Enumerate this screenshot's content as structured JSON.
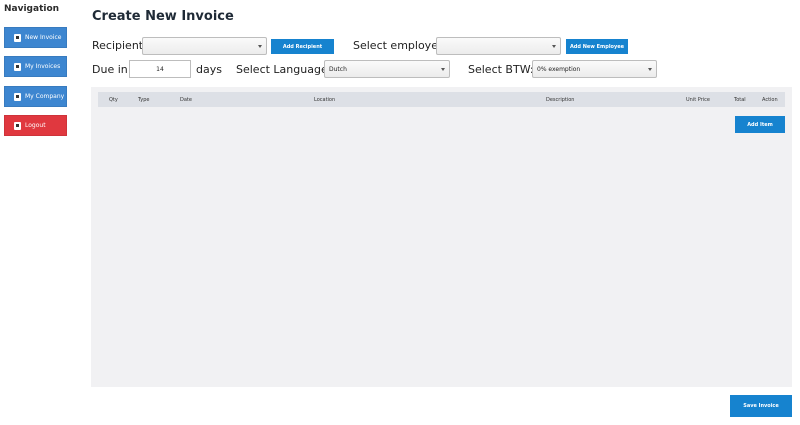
{
  "nav": {
    "title": "Navigation",
    "items": [
      {
        "label": "New Invoice",
        "icon": "user-icon"
      },
      {
        "label": "My Invoices",
        "icon": "invoice-icon"
      },
      {
        "label": "My Company",
        "icon": "company-icon"
      },
      {
        "label": "Logout",
        "icon": "logout-icon"
      }
    ]
  },
  "page": {
    "title": "Create New Invoice"
  },
  "form": {
    "recipient_label": "Recipient:",
    "recipient_value": "",
    "add_recipient_label": "Add Recipient",
    "employee_label": "Select employee:",
    "employee_value": "",
    "add_employee_label": "Add New Employee",
    "due_label": "Due in:",
    "due_value": "14",
    "days_label": "days",
    "language_label": "Select Language:",
    "language_value": "Dutch",
    "btw_label": "Select BTW:",
    "btw_value": "0% exemption"
  },
  "table": {
    "columns": [
      "Qty",
      "Type",
      "Date",
      "Location",
      "Description",
      "Unit Price",
      "Total",
      "Action"
    ],
    "add_item_label": "Add Item"
  },
  "footer": {
    "save_label": "Save Invoice"
  },
  "colors": {
    "nav_blue": "#3d86d0",
    "nav_red": "#e0383f",
    "button_blue": "#1683cf"
  }
}
